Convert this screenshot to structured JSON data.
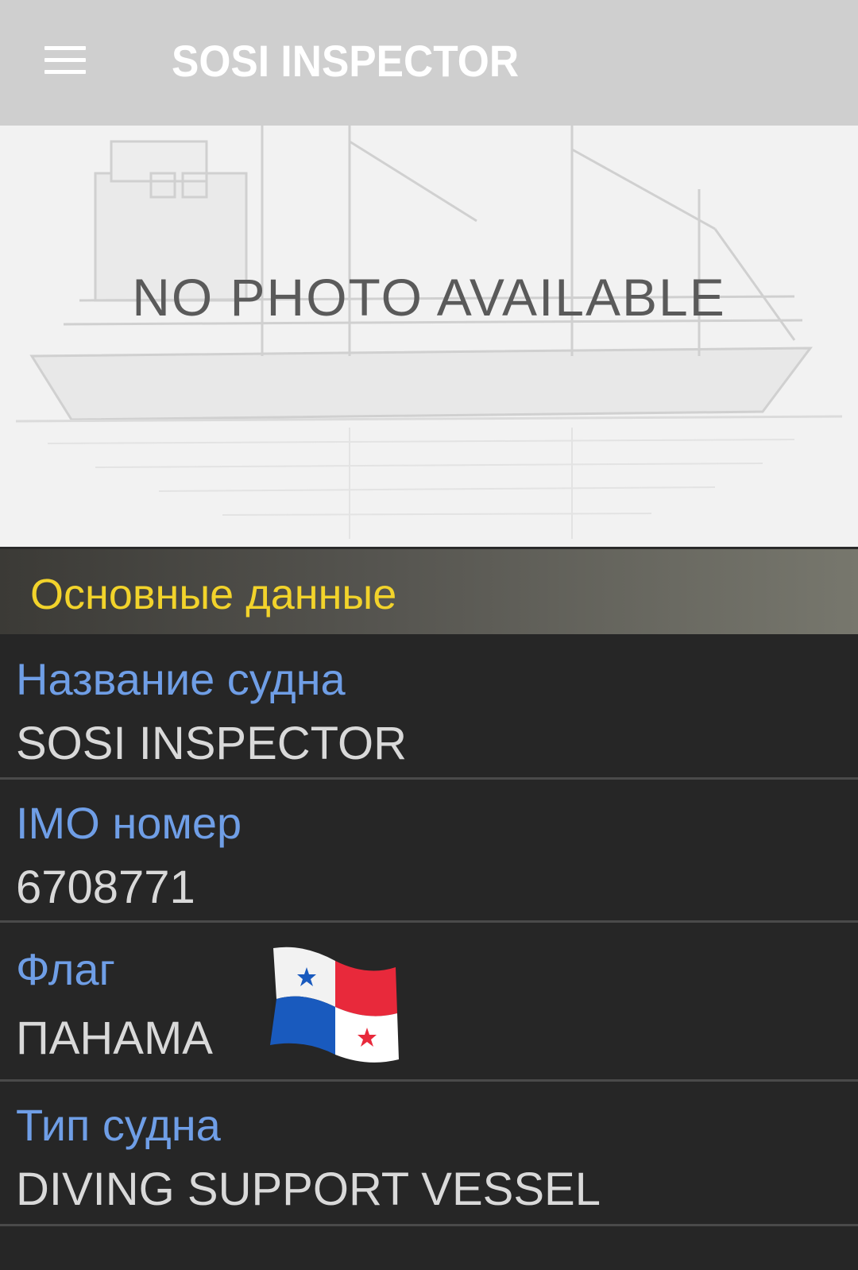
{
  "appbar": {
    "title": "SOSI INSPECTOR",
    "menu_icon": "hamburger-menu-icon"
  },
  "photo": {
    "placeholder_text": "NO PHOTO AVAILABLE"
  },
  "section": {
    "title": "Основные данные"
  },
  "fields": {
    "name": {
      "label": "Название судна",
      "value": "SOSI INSPECTOR"
    },
    "imo": {
      "label": "IMO номер",
      "value": "6708771"
    },
    "flag": {
      "label": "Флаг",
      "value": "ПАНАМА",
      "flag_icon": "panama-flag-icon"
    },
    "type": {
      "label": "Тип судна",
      "value": "DIVING SUPPORT VESSEL"
    }
  },
  "colors": {
    "appbar_bg": "#cfcfcf",
    "section_title": "#f2d32b",
    "label": "#6f9ee6",
    "value": "#d9d9d9",
    "background": "#262626"
  }
}
